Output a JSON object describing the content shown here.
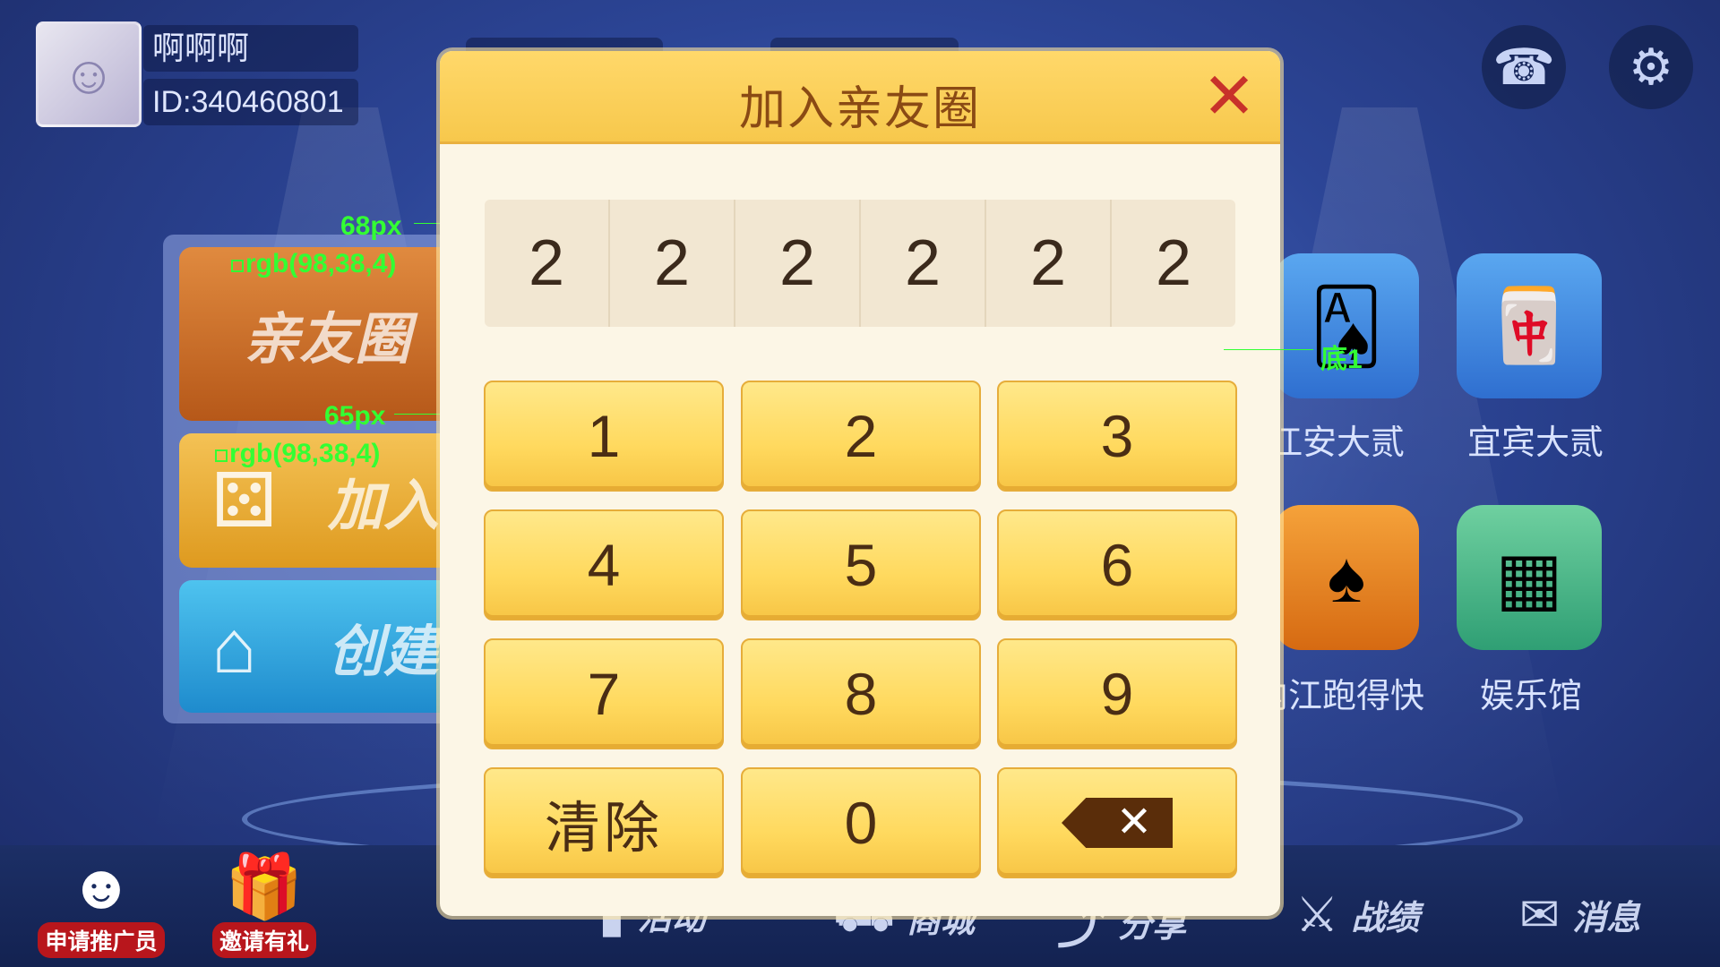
{
  "user": {
    "name": "啊啊啊",
    "id": "ID:340460801"
  },
  "header_icons": {
    "support": "headset-icon",
    "settings": "gear-icon"
  },
  "left_menu": {
    "items": [
      {
        "label": "亲友圈"
      },
      {
        "label": "加入"
      },
      {
        "label": "创建"
      }
    ]
  },
  "games": [
    {
      "label": "江安大贰",
      "icon": "mahjong-cards-icon"
    },
    {
      "label": "宜宾大贰",
      "icon": "mahjong-tiles-icon"
    },
    {
      "label": "内江跑得快",
      "icon": "playing-card-icon"
    },
    {
      "label": "娱乐馆",
      "icon": "tile-grid-icon"
    }
  ],
  "bottom_bar": {
    "promo1": "申请推广员",
    "promo2": "邀请有礼",
    "activity": "活动",
    "mall": "商城",
    "share": "分享",
    "record": "战绩",
    "message": "消息"
  },
  "annotations": {
    "a1_size": "68px",
    "a1_color": "rgb(98,38,4)",
    "a2_size": "65px",
    "a2_color": "rgb(98,38,4)",
    "a3_label": "底1"
  },
  "modal": {
    "title": "加入亲友圈",
    "code_digits": [
      "2",
      "2",
      "2",
      "2",
      "2",
      "2"
    ],
    "keys": [
      "1",
      "2",
      "3",
      "4",
      "5",
      "6",
      "7",
      "8",
      "9"
    ],
    "clear_label": "清除",
    "zero_label": "0",
    "backspace_icon": "backspace-icon",
    "colors": {
      "header": "#f7c84c",
      "body": "#fcf6e6",
      "key": "#ffd95e",
      "close": "#c8322a",
      "text": "#4a2d14"
    }
  }
}
